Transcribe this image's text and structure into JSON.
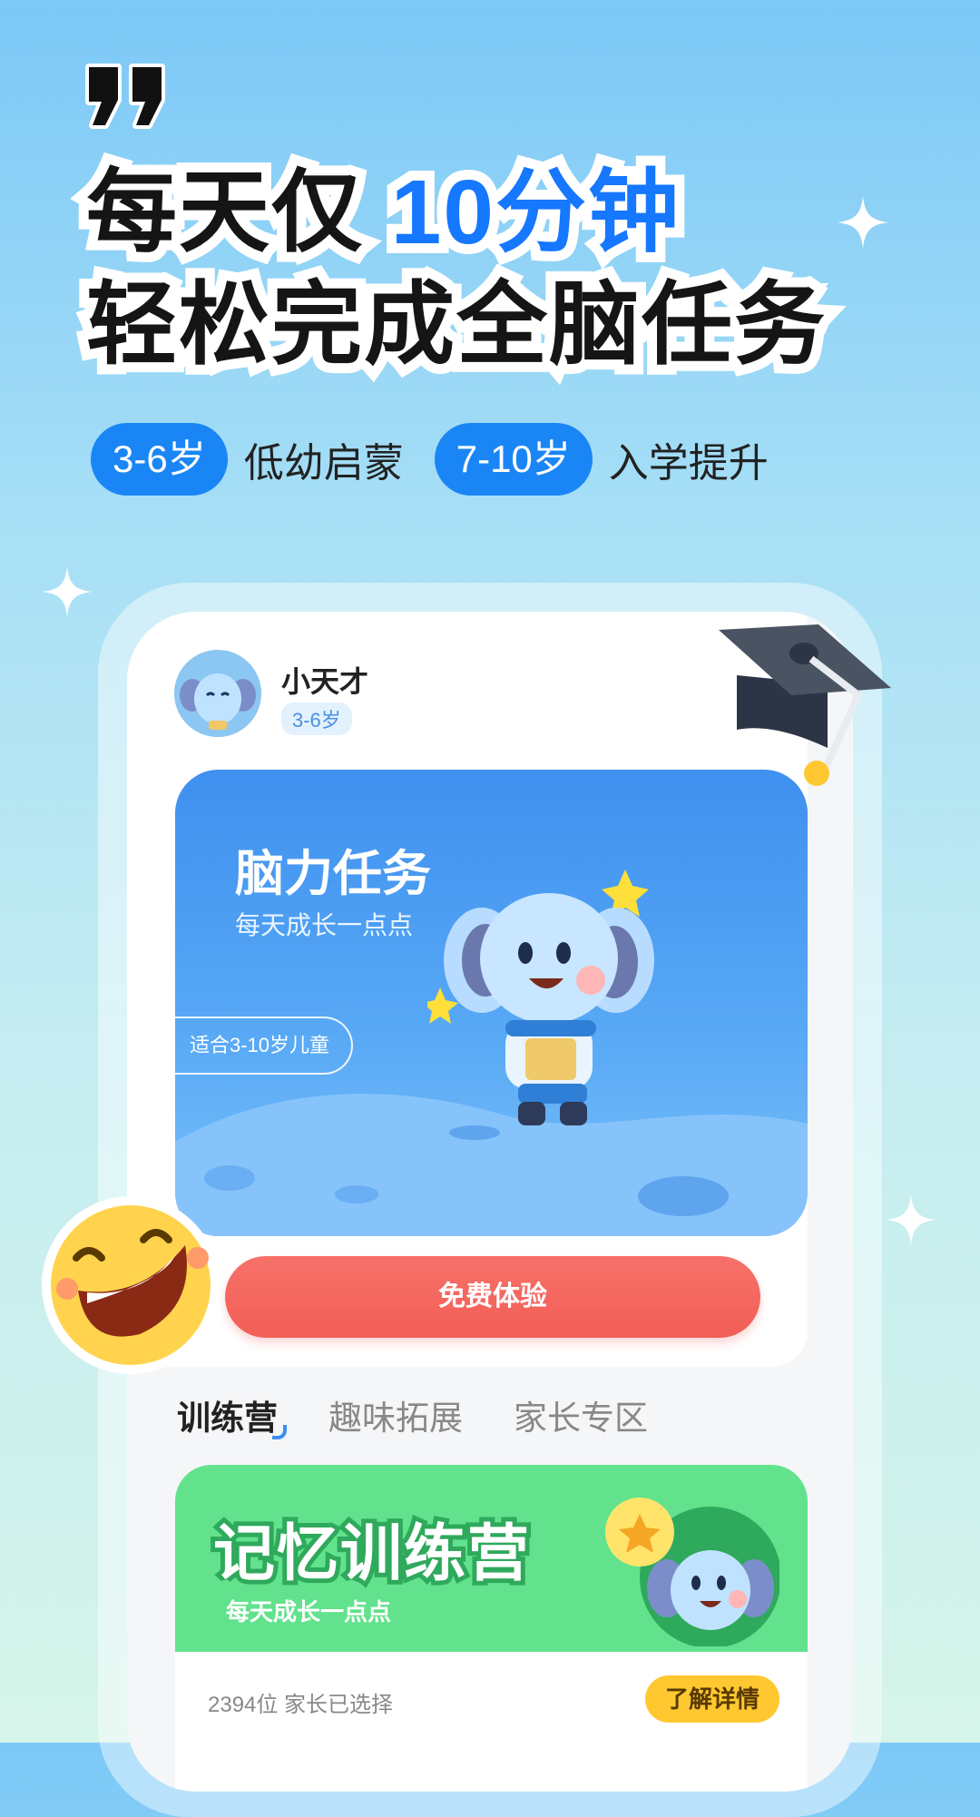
{
  "headline": {
    "line1_prefix": "每天仅",
    "line1_accent": "10分钟",
    "line2": "轻松完成全脑任务"
  },
  "tags": [
    {
      "pill": "3-6岁",
      "text": "低幼启蒙"
    },
    {
      "pill": "7-10岁",
      "text": "入学提升"
    }
  ],
  "user": {
    "name": "小天才",
    "age": "3-6岁"
  },
  "banner": {
    "title": "脑力任务",
    "subtitle": "每天成长一点点",
    "badge": "适合3-10岁儿童",
    "cta": "免费体验"
  },
  "tabs": [
    {
      "label": "训练营",
      "active": true
    },
    {
      "label": "趣味拓展",
      "active": false
    },
    {
      "label": "家长专区",
      "active": false
    }
  ],
  "camp": {
    "title": "记忆训练营",
    "subtitle": "每天成长一点点",
    "count": "2394位 家长已选择",
    "button": "了解详情"
  },
  "colors": {
    "accent": "#1677ff",
    "pill": "#1a86f5",
    "cta": "#f25e57",
    "camp_green": "#62e28d",
    "camp_button": "#ffc830"
  },
  "icons": [
    "quote-icon",
    "sparkle-icon",
    "graduation-cap-icon",
    "laughing-emoji-icon",
    "elephant-mascot"
  ]
}
